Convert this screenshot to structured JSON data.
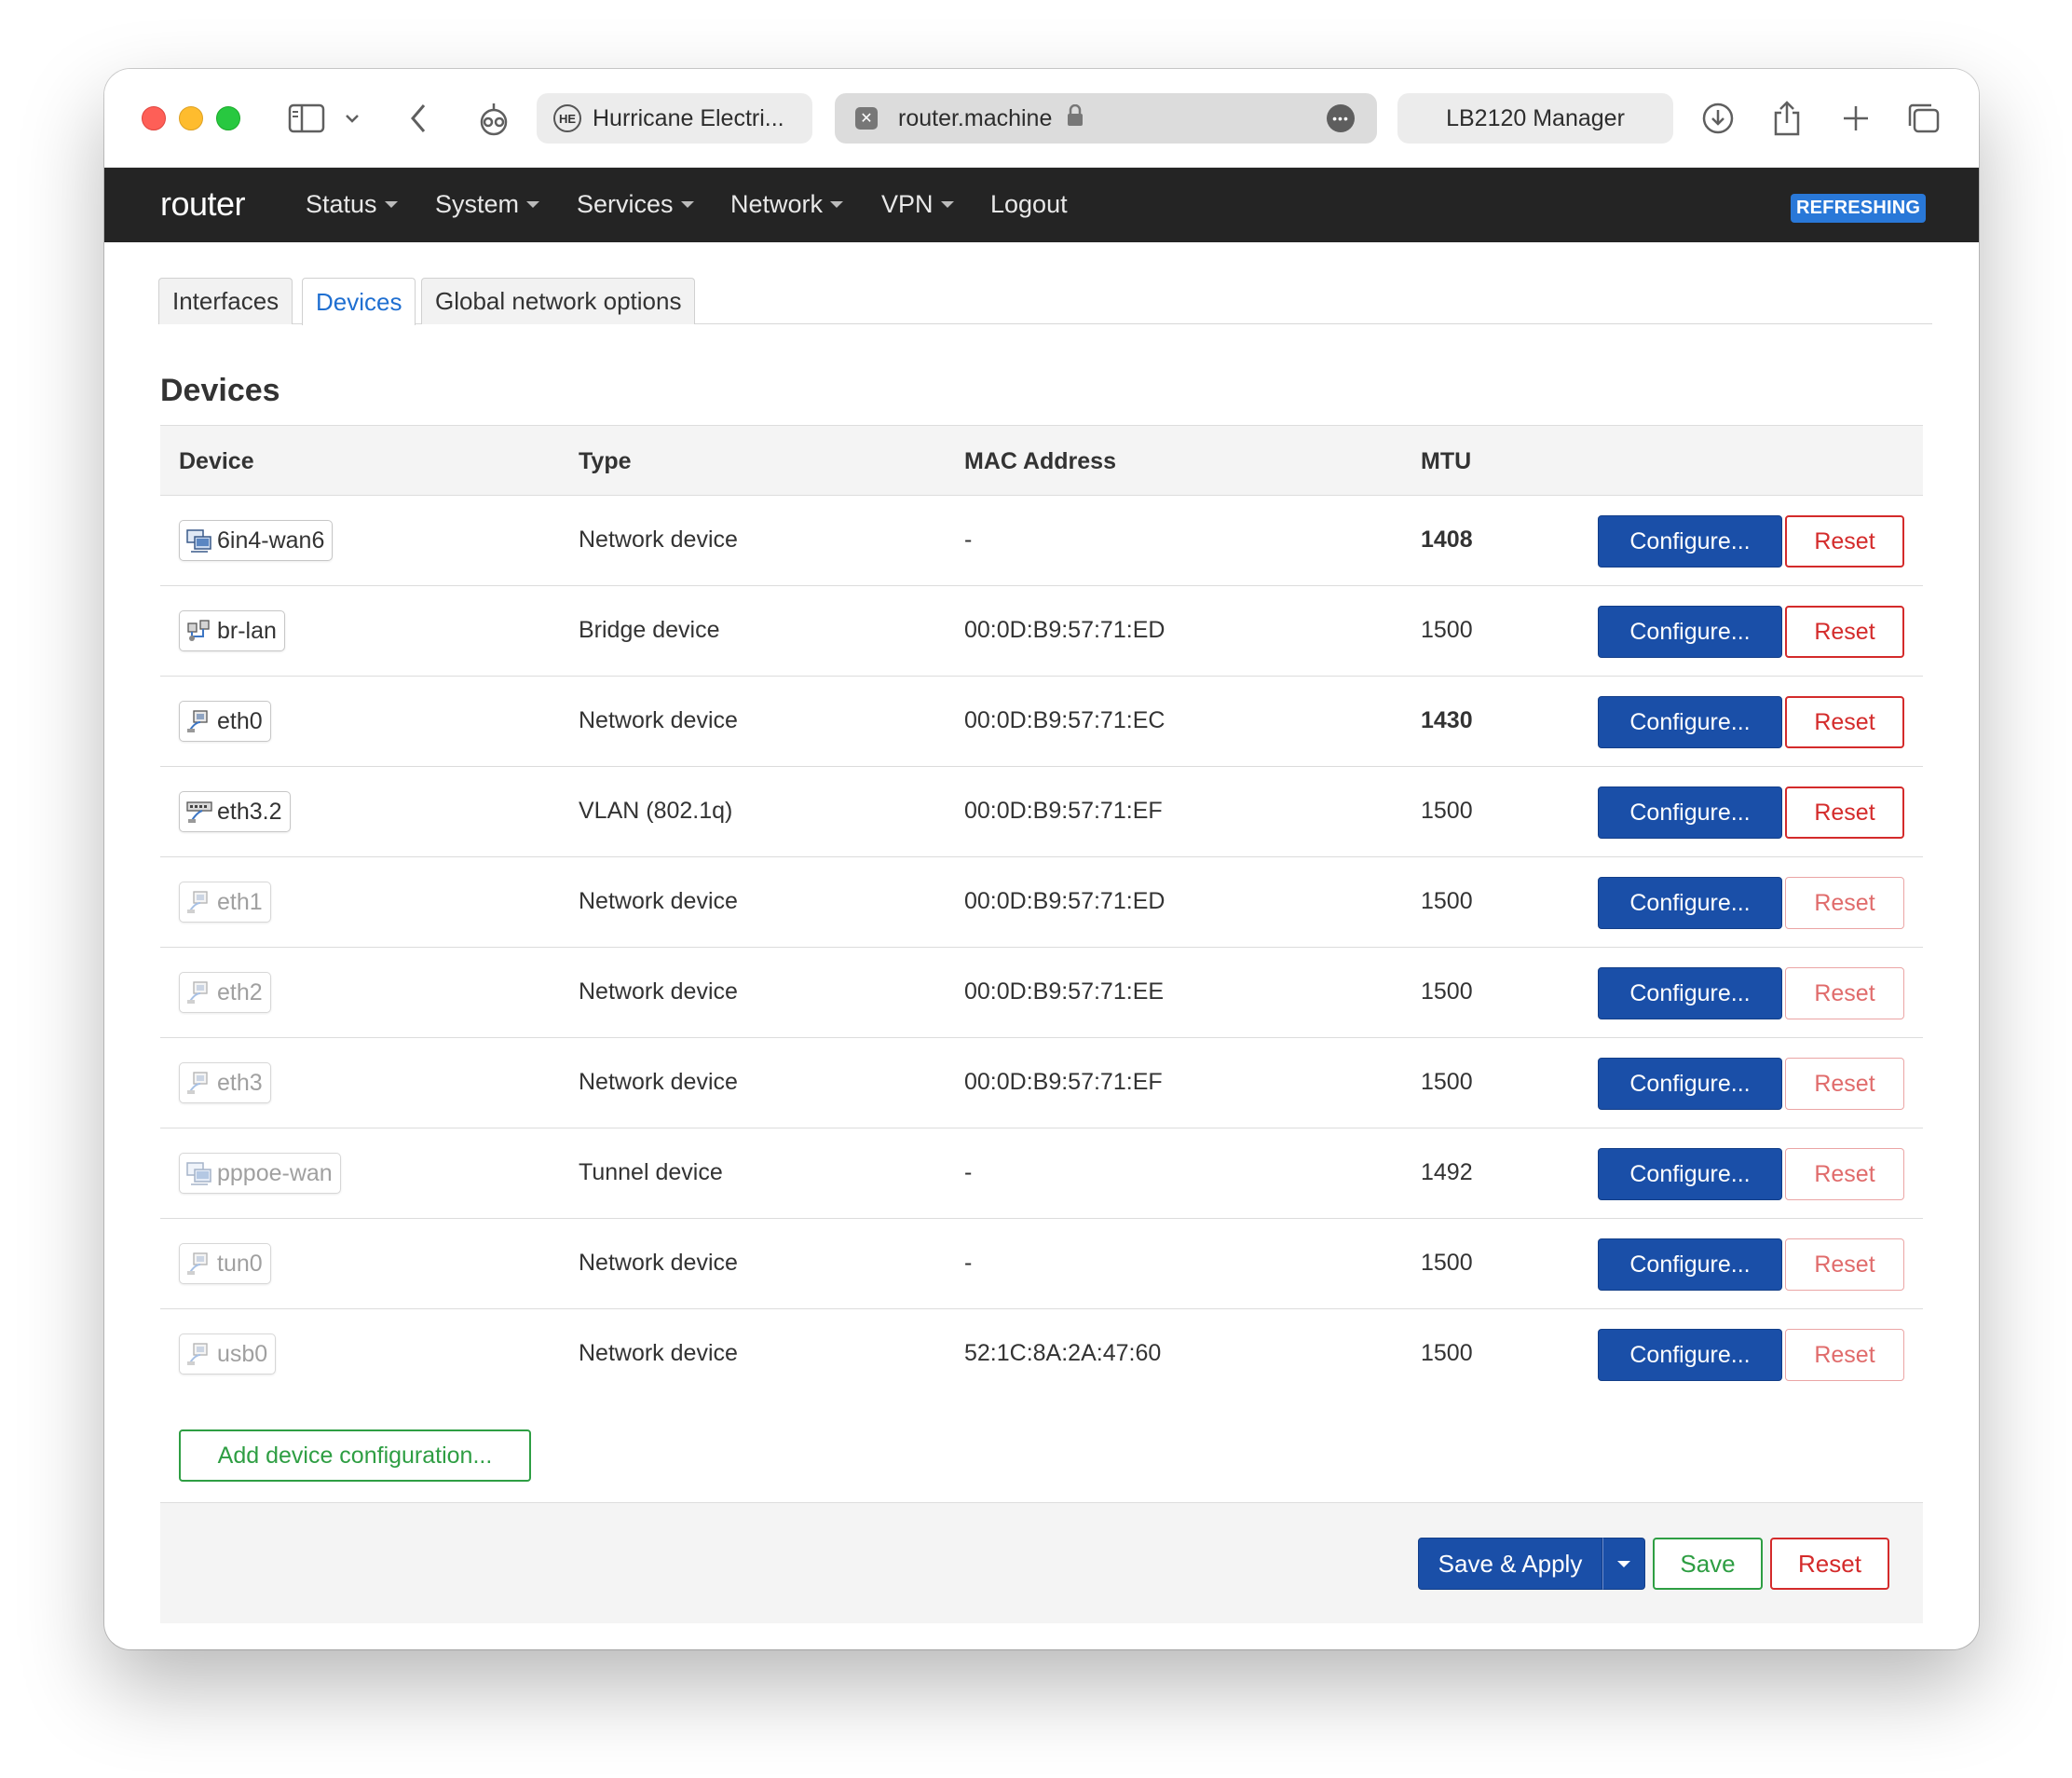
{
  "browser": {
    "tabs": [
      {
        "label": "Hurricane Electri...",
        "favicon": "he-icon"
      },
      {
        "label": "router.machine",
        "favicon": "close-tab-icon",
        "active": true
      },
      {
        "label": "LB2120 Manager"
      }
    ]
  },
  "navbar": {
    "brand": "router",
    "items": [
      "Status",
      "System",
      "Services",
      "Network",
      "VPN",
      "Logout"
    ],
    "badge": "REFRESHING"
  },
  "subtabs": [
    "Interfaces",
    "Devices",
    "Global network options"
  ],
  "section_title": "Devices",
  "table": {
    "headers": {
      "device": "Device",
      "type": "Type",
      "mac": "MAC Address",
      "mtu": "MTU"
    },
    "rows": [
      {
        "device": "6in4-wan6",
        "icon": "tunnel-icon",
        "active": true,
        "type": "Network device",
        "mac": "-",
        "mtu": "1408",
        "mtu_bold": true
      },
      {
        "device": "br-lan",
        "icon": "bridge-icon",
        "active": true,
        "type": "Bridge device",
        "mac": "00:0D:B9:57:71:ED",
        "mtu": "1500"
      },
      {
        "device": "eth0",
        "icon": "ethernet-icon",
        "active": true,
        "type": "Network device",
        "mac": "00:0D:B9:57:71:EC",
        "mtu": "1430",
        "mtu_bold": true
      },
      {
        "device": "eth3.2",
        "icon": "vlan-icon",
        "active": true,
        "type": "VLAN (802.1q)",
        "mac": "00:0D:B9:57:71:EF",
        "mtu": "1500"
      },
      {
        "device": "eth1",
        "icon": "ethernet-icon",
        "active": false,
        "type": "Network device",
        "mac": "00:0D:B9:57:71:ED",
        "mtu": "1500"
      },
      {
        "device": "eth2",
        "icon": "ethernet-icon",
        "active": false,
        "type": "Network device",
        "mac": "00:0D:B9:57:71:EE",
        "mtu": "1500"
      },
      {
        "device": "eth3",
        "icon": "ethernet-icon",
        "active": false,
        "type": "Network device",
        "mac": "00:0D:B9:57:71:EF",
        "mtu": "1500"
      },
      {
        "device": "pppoe-wan",
        "icon": "tunnel-icon",
        "active": false,
        "type": "Tunnel device",
        "mac": "-",
        "mtu": "1492"
      },
      {
        "device": "tun0",
        "icon": "ethernet-icon",
        "active": false,
        "type": "Network device",
        "mac": "-",
        "mtu": "1500"
      },
      {
        "device": "usb0",
        "icon": "ethernet-icon",
        "active": false,
        "type": "Network device",
        "mac": "52:1C:8A:2A:47:60",
        "mtu": "1500"
      }
    ],
    "configure_label": "Configure...",
    "reset_label": "Reset"
  },
  "add_device_label": "Add device configuration...",
  "footer": {
    "save_apply_label": "Save & Apply",
    "save_label": "Save",
    "reset_label": "Reset"
  },
  "colors": {
    "primary": "#1a4fa8",
    "danger": "#d42b2b",
    "success": "#2e9e43",
    "navbar": "#242424",
    "badge": "#2978d8"
  }
}
